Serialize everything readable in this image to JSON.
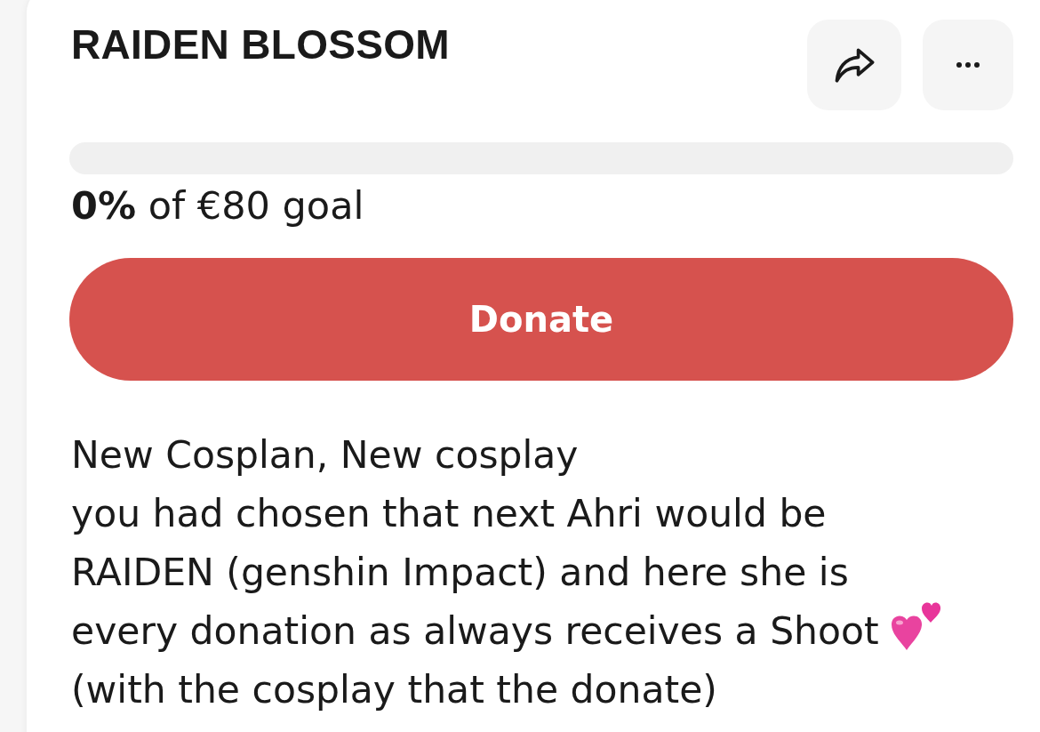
{
  "campaign": {
    "title": "RAIDEN BLOSSOM",
    "goal_text": "**0%** of €80 goal",
    "donate_button": "Donate",
    "description": [
      {
        "text": "New Cosplan, New cosplay",
        "emoji": false
      },
      {
        "text": "you had chosen that next Ahri would be",
        "emoji": false
      },
      {
        "text": "RAIDEN (genshin Impact) and here she is",
        "emoji": false
      },
      {
        "text": "every donation as always receives a Shoot",
        "emoji": true
      },
      {
        "text": "(with the cosplay that the donate)",
        "emoji": false
      }
    ]
  }
}
